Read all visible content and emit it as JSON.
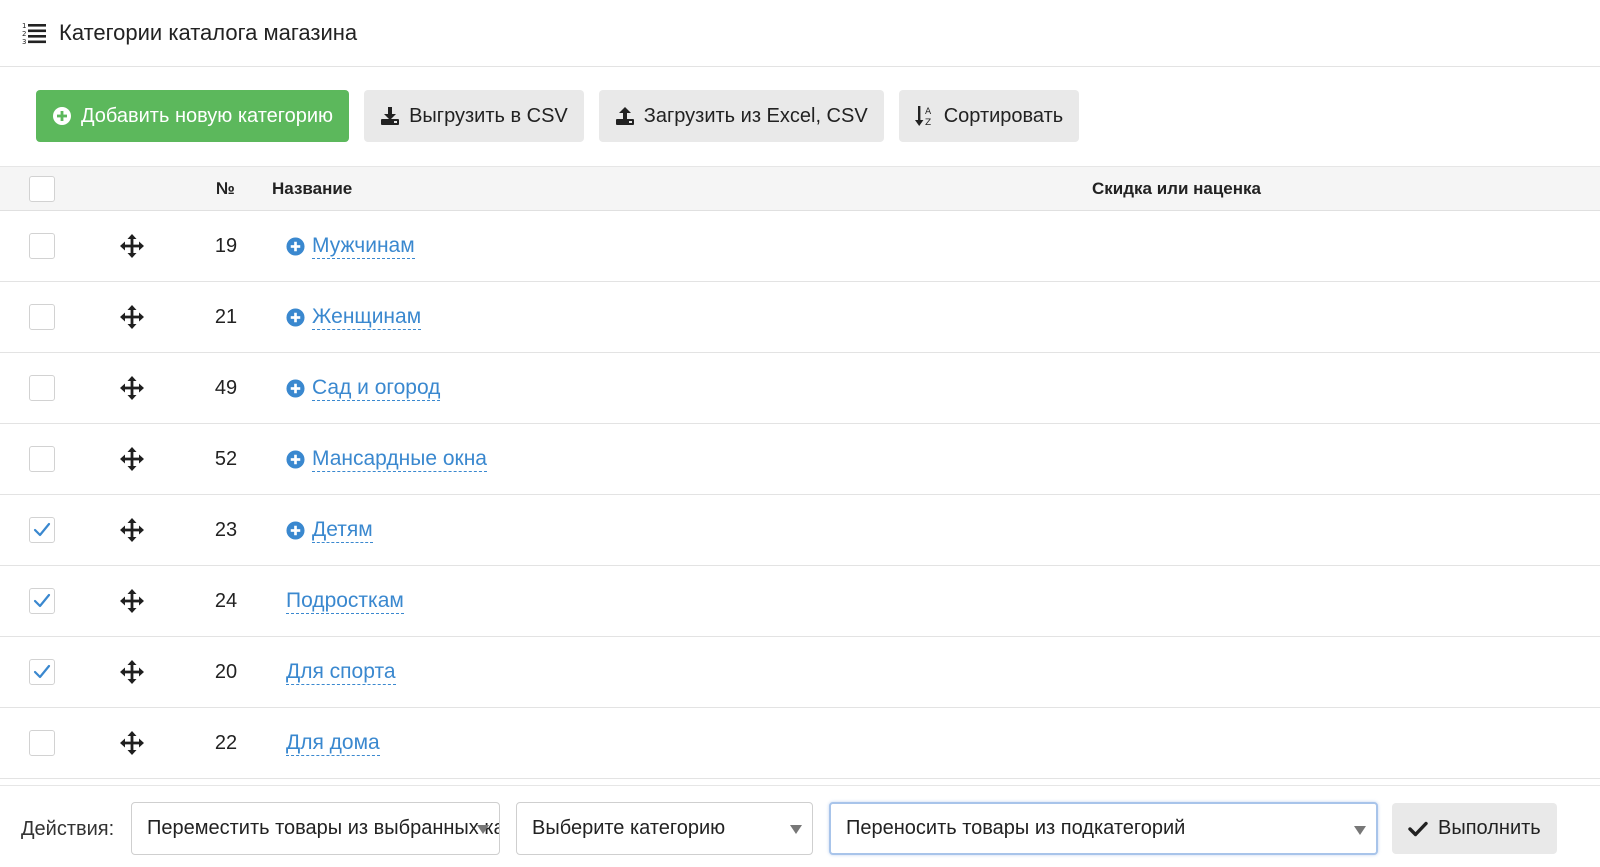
{
  "header": {
    "title": "Категории каталога магазина",
    "icon": "numbered-list-icon"
  },
  "toolbar": {
    "add_label": "Добавить новую категорию",
    "export_label": "Выгрузить в CSV",
    "import_label": "Загрузить из Excel, CSV",
    "sort_label": "Сортировать"
  },
  "colors": {
    "accent_green": "#5cb85c",
    "link_blue": "#3a88cf",
    "checkbox_check": "#3a88cf"
  },
  "table": {
    "columns": {
      "num": "№",
      "name": "Название",
      "discount": "Скидка или наценка"
    },
    "rows": [
      {
        "id": "19",
        "name": "Мужчинам",
        "has_children": true,
        "checked": false
      },
      {
        "id": "21",
        "name": "Женщинам",
        "has_children": true,
        "checked": false
      },
      {
        "id": "49",
        "name": "Сад и огород",
        "has_children": true,
        "checked": false
      },
      {
        "id": "52",
        "name": "Мансардные окна",
        "has_children": true,
        "checked": false
      },
      {
        "id": "23",
        "name": "Детям",
        "has_children": true,
        "checked": true
      },
      {
        "id": "24",
        "name": "Подросткам",
        "has_children": false,
        "checked": true
      },
      {
        "id": "20",
        "name": "Для спорта",
        "has_children": false,
        "checked": true
      },
      {
        "id": "22",
        "name": "Для дома",
        "has_children": false,
        "checked": false
      }
    ]
  },
  "actions": {
    "label": "Действия:",
    "action_select_value": "Переместить товары из выбранных категорий",
    "category_select_value": "Выберите категорию",
    "subcategory_select_value": "Переносить товары из подкатегорий",
    "execute_label": "Выполнить"
  }
}
